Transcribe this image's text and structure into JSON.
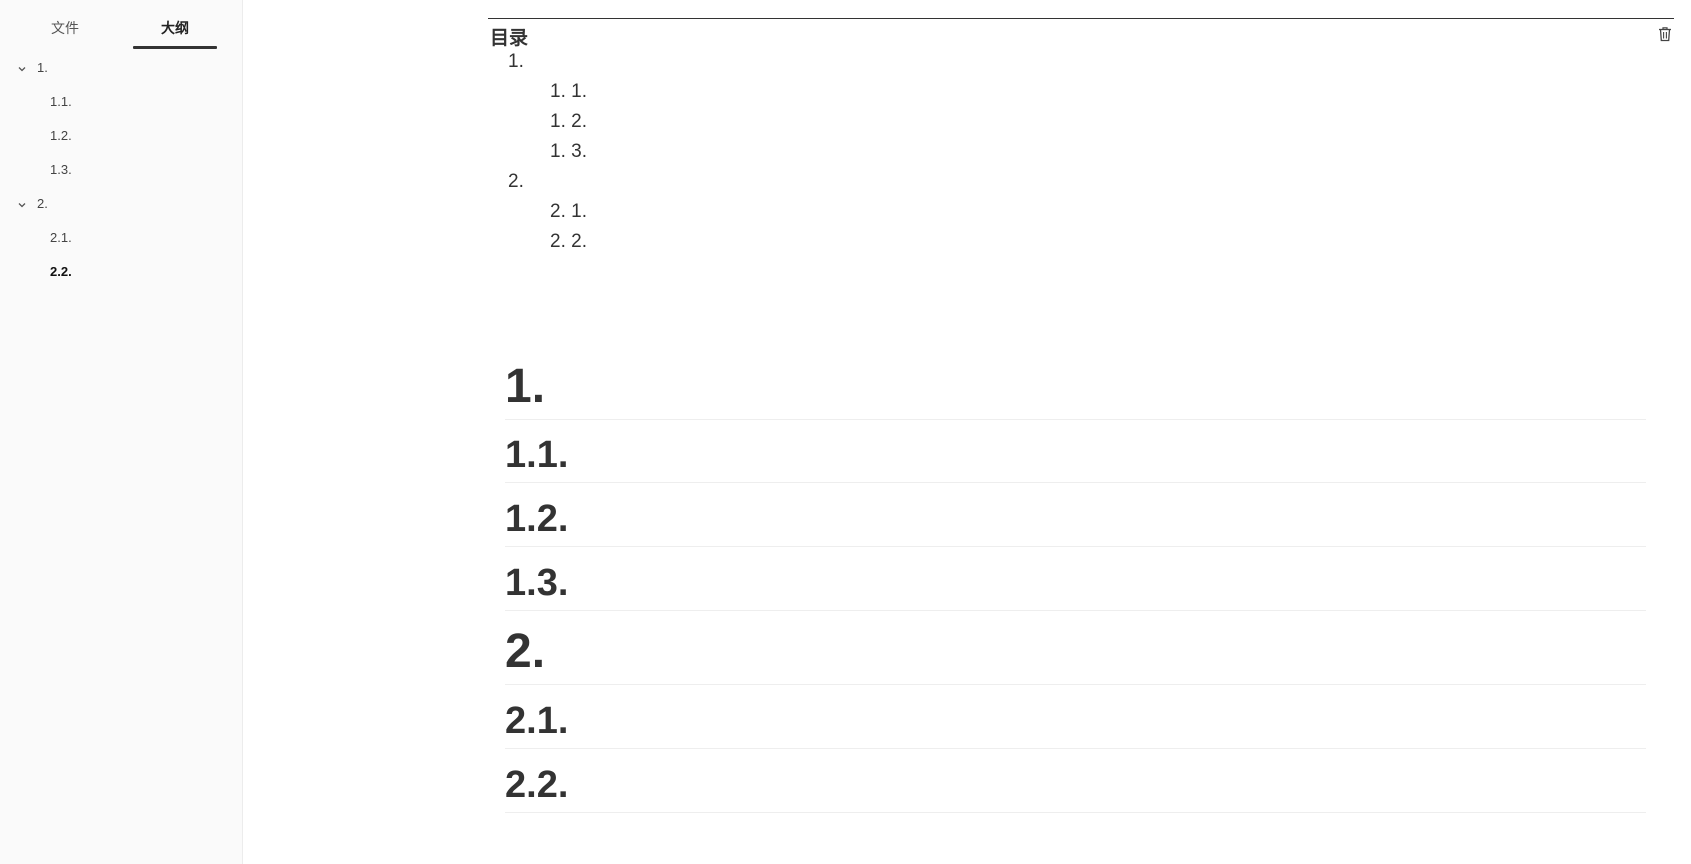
{
  "sidebar": {
    "tabs": [
      {
        "label": "文件"
      },
      {
        "label": "大纲"
      }
    ],
    "outline": [
      {
        "label": "1."
      },
      {
        "label": "1.1."
      },
      {
        "label": "1.2."
      },
      {
        "label": "1.3."
      },
      {
        "label": "2."
      },
      {
        "label": "2.1."
      },
      {
        "label": "2.2."
      }
    ]
  },
  "toc": {
    "title": "目录",
    "entries": [
      {
        "label": "1."
      },
      {
        "label": "1. 1."
      },
      {
        "label": "1. 2."
      },
      {
        "label": "1. 3."
      },
      {
        "label": "2."
      },
      {
        "label": "2. 1."
      },
      {
        "label": "2. 2."
      }
    ]
  },
  "headings": [
    {
      "label": "1."
    },
    {
      "label": "1.1."
    },
    {
      "label": "1.2."
    },
    {
      "label": "1.3."
    },
    {
      "label": "2."
    },
    {
      "label": "2.1."
    },
    {
      "label": "2.2."
    }
  ],
  "icons": {
    "chevron": "chevron-down-icon",
    "trash": "trash-icon"
  }
}
